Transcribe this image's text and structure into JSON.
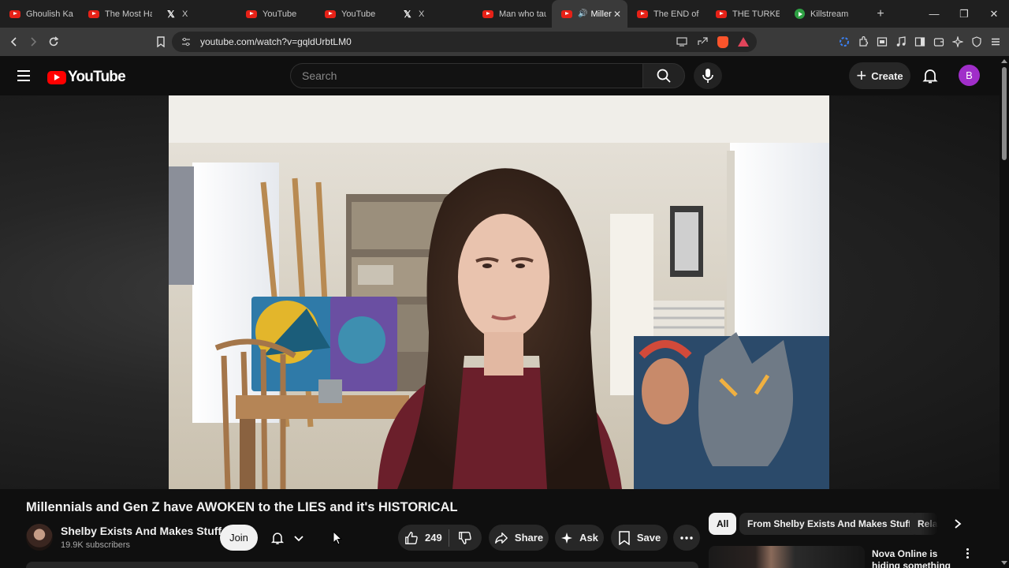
{
  "browser": {
    "tabs": [
      {
        "title": "Ghoulish Kar",
        "icon": "youtube-icon"
      },
      {
        "title": "The Most Ha",
        "icon": "youtube-icon"
      },
      {
        "title": "X",
        "icon": "x-icon"
      },
      {
        "title": "YouTube",
        "icon": "youtube-icon"
      },
      {
        "title": "YouTube",
        "icon": "youtube-icon"
      },
      {
        "title": "X",
        "icon": "x-icon"
      },
      {
        "title": "Man who tau",
        "icon": "youtube-icon"
      },
      {
        "title": "Miller",
        "icon": "youtube-icon",
        "active": true,
        "audio": "🔊",
        "close": "✕"
      },
      {
        "title": "The END of U",
        "icon": "youtube-icon"
      },
      {
        "title": "THE TURKEY",
        "icon": "youtube-icon"
      },
      {
        "title": "Killstream",
        "icon": "play-icon"
      }
    ],
    "new_tab": "+",
    "window_controls": {
      "minimize": "—",
      "restore": "❐",
      "close": "✕"
    },
    "url": "youtube.com/watch?v=gqldUrbtLM0",
    "brave_badge_color": "#fb542b"
  },
  "youtube": {
    "logo_text": "YouTube",
    "search_placeholder": "Search",
    "create_label": "Create",
    "create_plus": "+",
    "avatar_letter": "B",
    "avatar_color": "#a02ec9"
  },
  "video": {
    "title": "Millennials and Gen Z have AWOKEN to the LIES and it's HISTORICAL",
    "channel": {
      "name": "Shelby Exists And Makes Stuff",
      "subscribers": "19.9K subscribers"
    },
    "join_label": "Join",
    "likes": "249",
    "share_label": "Share",
    "ask_label": "Ask",
    "save_label": "Save"
  },
  "sidebar": {
    "chips": {
      "all": "All",
      "from": "From Shelby Exists And Makes Stuff",
      "related": "Related"
    },
    "recommendation": {
      "title": "Nova Online is hiding something"
    }
  }
}
